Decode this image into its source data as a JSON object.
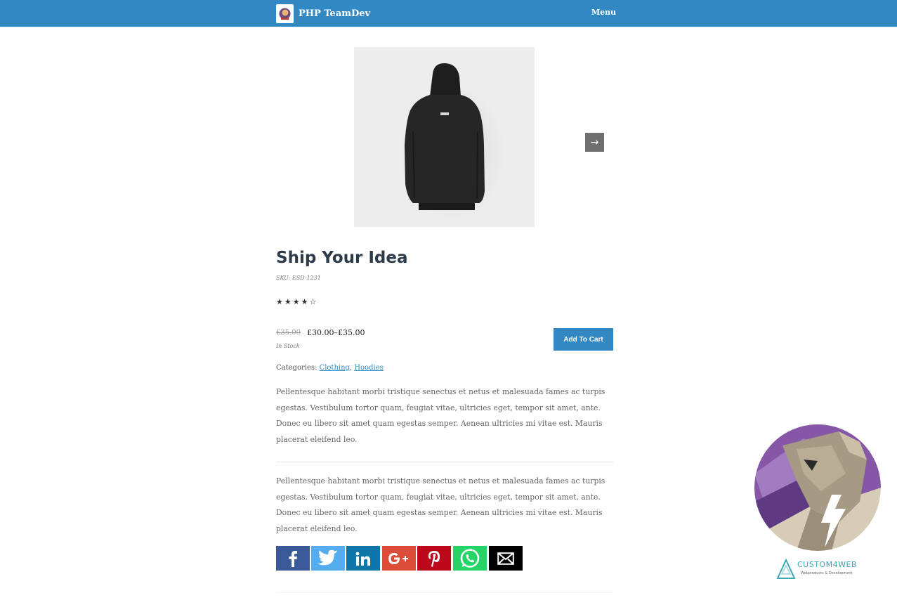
{
  "header": {
    "brand": "PHP TeamDev",
    "menu_label": "Menu"
  },
  "product": {
    "title": "Ship Your Idea",
    "sku": "SKU: ESD-1231",
    "rating": 4,
    "rating_max": 5,
    "stars_text": "★★★★☆",
    "old_price": "£35.00",
    "price": "£30.00–£35.00",
    "stock": "In Stock",
    "add_to_cart": "Add To Cart",
    "categories_label": "Categories:",
    "categories": [
      "Clothing",
      "Hoodies"
    ],
    "category_separator": ",",
    "description_1": "Pellentesque habitant morbi tristique senectus et netus et malesuada fames ac turpis egestas. Vestibulum tortor quam, feugiat vitae, ultricies eget, tempor sit amet, ante. Donec eu libero sit amet quam egestas semper. Aenean ultricies mi vitae est. Mauris placerat eleifend leo.",
    "description_2": "Pellentesque habitant morbi tristique senectus et netus et malesuada fames ac turpis egestas. Vestibulum tortor quam, feugiat vitae, ultricies eget, tempor sit amet, ante. Donec eu libero sit amet quam egestas semper. Aenean ultricies mi vitae est. Mauris placerat eleifend leo."
  },
  "share": [
    {
      "name": "facebook",
      "color": "#3b5998"
    },
    {
      "name": "twitter",
      "color": "#55acee"
    },
    {
      "name": "linkedin",
      "color": "#0e76a8"
    },
    {
      "name": "google-plus",
      "color": "#dd4b39"
    },
    {
      "name": "pinterest",
      "color": "#bd081c"
    },
    {
      "name": "whatsapp",
      "color": "#25d366"
    },
    {
      "name": "email",
      "color": "#000000"
    }
  ],
  "watermark": {
    "brand": "CUSTOM4WEB",
    "tagline": "Webproducts & Development"
  },
  "colors": {
    "accent": "#3188c3",
    "title": "#2e3c49"
  }
}
